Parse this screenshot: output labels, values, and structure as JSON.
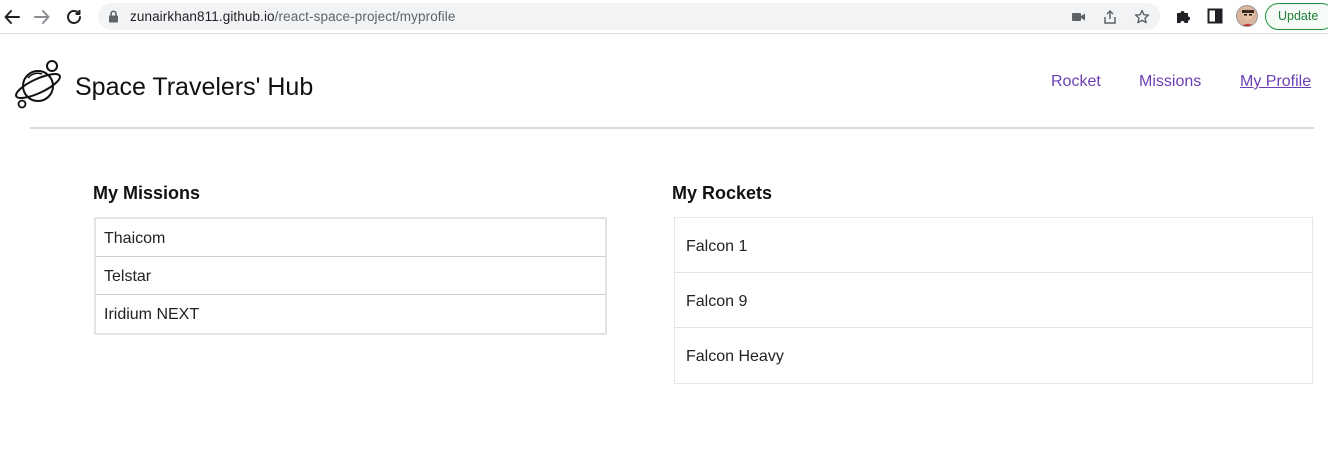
{
  "browser": {
    "url_host": "zunairkhan811.github.io",
    "url_path": "/react-space-project/myprofile",
    "update_label": "Update",
    "icons": [
      "back-arrow-icon",
      "forward-arrow-icon",
      "reload-icon",
      "lock-icon",
      "camera-blocked-icon",
      "share-icon",
      "star-bookmark-icon",
      "extensions-puzzle-icon",
      "side-panel-icon",
      "profile-avatar"
    ]
  },
  "header": {
    "brand": "Space Travelers' Hub",
    "logo_icon": "planet-logo-icon",
    "nav": [
      {
        "label": "Rocket",
        "active": false
      },
      {
        "label": "Missions",
        "active": false
      },
      {
        "label": "My Profile",
        "active": true
      }
    ],
    "link_color": "#6b3fb5"
  },
  "missions": {
    "title": "My Missions",
    "items": [
      "Thaicom",
      "Telstar",
      "Iridium NEXT"
    ]
  },
  "rockets": {
    "title": "My Rockets",
    "items": [
      "Falcon 1",
      "Falcon 9",
      "Falcon Heavy"
    ]
  }
}
